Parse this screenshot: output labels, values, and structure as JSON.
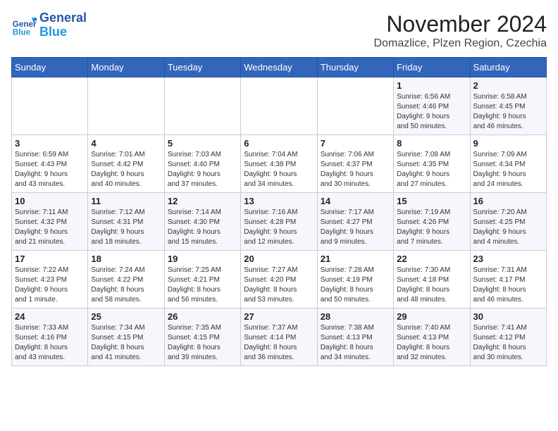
{
  "header": {
    "logo_text_general": "General",
    "logo_text_blue": "Blue",
    "month_title": "November 2024",
    "location": "Domazlice, Plzen Region, Czechia"
  },
  "weekdays": [
    "Sunday",
    "Monday",
    "Tuesday",
    "Wednesday",
    "Thursday",
    "Friday",
    "Saturday"
  ],
  "weeks": [
    [
      {
        "day": "",
        "info": ""
      },
      {
        "day": "",
        "info": ""
      },
      {
        "day": "",
        "info": ""
      },
      {
        "day": "",
        "info": ""
      },
      {
        "day": "",
        "info": ""
      },
      {
        "day": "1",
        "info": "Sunrise: 6:56 AM\nSunset: 4:46 PM\nDaylight: 9 hours\nand 50 minutes."
      },
      {
        "day": "2",
        "info": "Sunrise: 6:58 AM\nSunset: 4:45 PM\nDaylight: 9 hours\nand 46 minutes."
      }
    ],
    [
      {
        "day": "3",
        "info": "Sunrise: 6:59 AM\nSunset: 4:43 PM\nDaylight: 9 hours\nand 43 minutes."
      },
      {
        "day": "4",
        "info": "Sunrise: 7:01 AM\nSunset: 4:42 PM\nDaylight: 9 hours\nand 40 minutes."
      },
      {
        "day": "5",
        "info": "Sunrise: 7:03 AM\nSunset: 4:40 PM\nDaylight: 9 hours\nand 37 minutes."
      },
      {
        "day": "6",
        "info": "Sunrise: 7:04 AM\nSunset: 4:38 PM\nDaylight: 9 hours\nand 34 minutes."
      },
      {
        "day": "7",
        "info": "Sunrise: 7:06 AM\nSunset: 4:37 PM\nDaylight: 9 hours\nand 30 minutes."
      },
      {
        "day": "8",
        "info": "Sunrise: 7:08 AM\nSunset: 4:35 PM\nDaylight: 9 hours\nand 27 minutes."
      },
      {
        "day": "9",
        "info": "Sunrise: 7:09 AM\nSunset: 4:34 PM\nDaylight: 9 hours\nand 24 minutes."
      }
    ],
    [
      {
        "day": "10",
        "info": "Sunrise: 7:11 AM\nSunset: 4:32 PM\nDaylight: 9 hours\nand 21 minutes."
      },
      {
        "day": "11",
        "info": "Sunrise: 7:12 AM\nSunset: 4:31 PM\nDaylight: 9 hours\nand 18 minutes."
      },
      {
        "day": "12",
        "info": "Sunrise: 7:14 AM\nSunset: 4:30 PM\nDaylight: 9 hours\nand 15 minutes."
      },
      {
        "day": "13",
        "info": "Sunrise: 7:16 AM\nSunset: 4:28 PM\nDaylight: 9 hours\nand 12 minutes."
      },
      {
        "day": "14",
        "info": "Sunrise: 7:17 AM\nSunset: 4:27 PM\nDaylight: 9 hours\nand 9 minutes."
      },
      {
        "day": "15",
        "info": "Sunrise: 7:19 AM\nSunset: 4:26 PM\nDaylight: 9 hours\nand 7 minutes."
      },
      {
        "day": "16",
        "info": "Sunrise: 7:20 AM\nSunset: 4:25 PM\nDaylight: 9 hours\nand 4 minutes."
      }
    ],
    [
      {
        "day": "17",
        "info": "Sunrise: 7:22 AM\nSunset: 4:23 PM\nDaylight: 9 hours\nand 1 minute."
      },
      {
        "day": "18",
        "info": "Sunrise: 7:24 AM\nSunset: 4:22 PM\nDaylight: 8 hours\nand 58 minutes."
      },
      {
        "day": "19",
        "info": "Sunrise: 7:25 AM\nSunset: 4:21 PM\nDaylight: 8 hours\nand 56 minutes."
      },
      {
        "day": "20",
        "info": "Sunrise: 7:27 AM\nSunset: 4:20 PM\nDaylight: 8 hours\nand 53 minutes."
      },
      {
        "day": "21",
        "info": "Sunrise: 7:28 AM\nSunset: 4:19 PM\nDaylight: 8 hours\nand 50 minutes."
      },
      {
        "day": "22",
        "info": "Sunrise: 7:30 AM\nSunset: 4:18 PM\nDaylight: 8 hours\nand 48 minutes."
      },
      {
        "day": "23",
        "info": "Sunrise: 7:31 AM\nSunset: 4:17 PM\nDaylight: 8 hours\nand 46 minutes."
      }
    ],
    [
      {
        "day": "24",
        "info": "Sunrise: 7:33 AM\nSunset: 4:16 PM\nDaylight: 8 hours\nand 43 minutes."
      },
      {
        "day": "25",
        "info": "Sunrise: 7:34 AM\nSunset: 4:15 PM\nDaylight: 8 hours\nand 41 minutes."
      },
      {
        "day": "26",
        "info": "Sunrise: 7:35 AM\nSunset: 4:15 PM\nDaylight: 8 hours\nand 39 minutes."
      },
      {
        "day": "27",
        "info": "Sunrise: 7:37 AM\nSunset: 4:14 PM\nDaylight: 8 hours\nand 36 minutes."
      },
      {
        "day": "28",
        "info": "Sunrise: 7:38 AM\nSunset: 4:13 PM\nDaylight: 8 hours\nand 34 minutes."
      },
      {
        "day": "29",
        "info": "Sunrise: 7:40 AM\nSunset: 4:13 PM\nDaylight: 8 hours\nand 32 minutes."
      },
      {
        "day": "30",
        "info": "Sunrise: 7:41 AM\nSunset: 4:12 PM\nDaylight: 8 hours\nand 30 minutes."
      }
    ]
  ]
}
